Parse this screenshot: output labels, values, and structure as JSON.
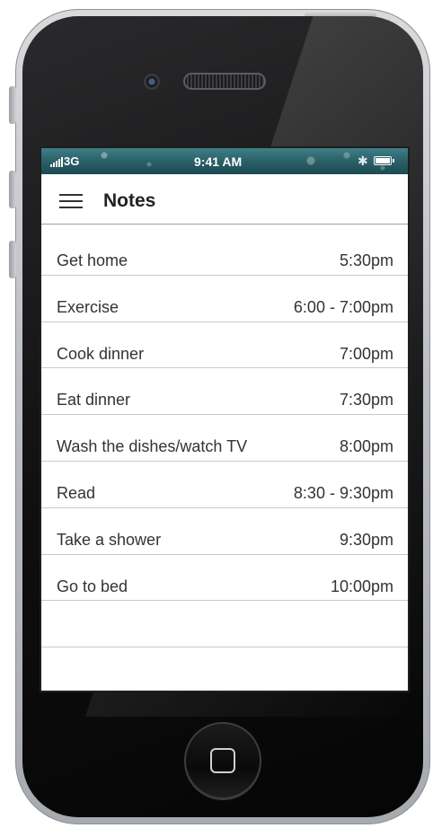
{
  "status_bar": {
    "network": "3G",
    "time": "9:41 AM"
  },
  "header": {
    "title": "Notes",
    "menu_icon": "hamburger-menu-icon"
  },
  "notes": [
    {
      "label": "Get home",
      "time": "5:30pm"
    },
    {
      "label": "Exercise",
      "time": "6:00 - 7:00pm"
    },
    {
      "label": "Cook dinner",
      "time": "7:00pm"
    },
    {
      "label": "Eat dinner",
      "time": "7:30pm"
    },
    {
      "label": "Wash the dishes/watch TV",
      "time": "8:00pm"
    },
    {
      "label": "Read",
      "time": "8:30 - 9:30pm"
    },
    {
      "label": "Take a shower",
      "time": "9:30pm"
    },
    {
      "label": "Go to bed",
      "time": "10:00pm"
    },
    {
      "label": "",
      "time": ""
    },
    {
      "label": "",
      "time": ""
    }
  ],
  "colors": {
    "status_bar": "#2b6068",
    "text": "#333333",
    "divider": "#c9c9c9"
  }
}
